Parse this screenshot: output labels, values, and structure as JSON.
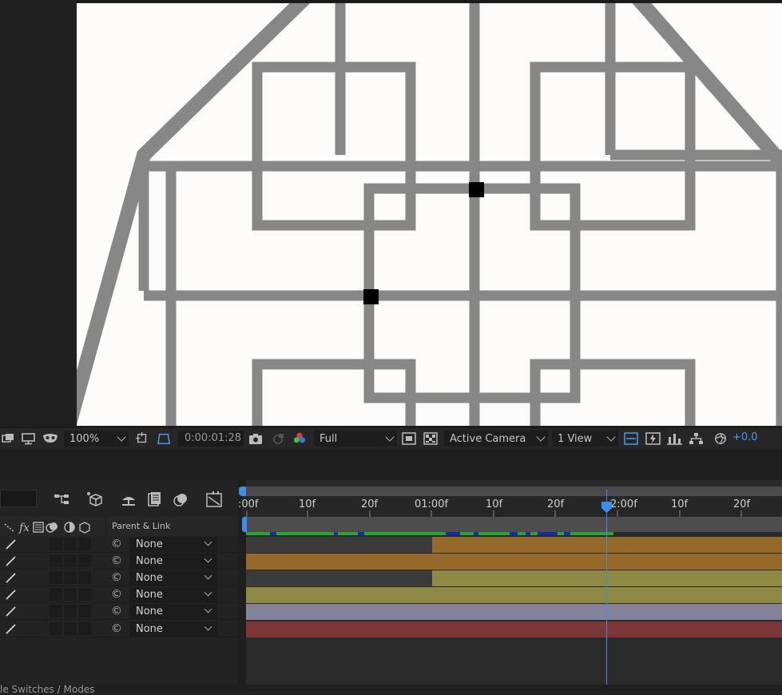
{
  "viewer": {
    "zoom": "100%",
    "timecode": "0:00:01:28",
    "resolution": "Full",
    "camera": "Active Camera",
    "views": "1 View",
    "exposure": "+0.0"
  },
  "timeline": {
    "parent_header": "Parent & Link",
    "ruler_labels": [
      ":00f",
      "10f",
      "20f",
      "01:00f",
      "10f",
      "20f",
      "2:00f",
      "10f",
      "20f"
    ],
    "layers": [
      {
        "parent": "None"
      },
      {
        "parent": "None"
      },
      {
        "parent": "None"
      },
      {
        "parent": "None"
      },
      {
        "parent": "None"
      },
      {
        "parent": "None"
      }
    ],
    "footer_label": "le Switches / Modes"
  },
  "colors": {
    "bar_orange": "#94692a",
    "bar_olive": "#8e8a45",
    "bar_lavender": "#85819a",
    "bar_red": "#7b3636",
    "accent_blue": "#3d8ee6"
  }
}
